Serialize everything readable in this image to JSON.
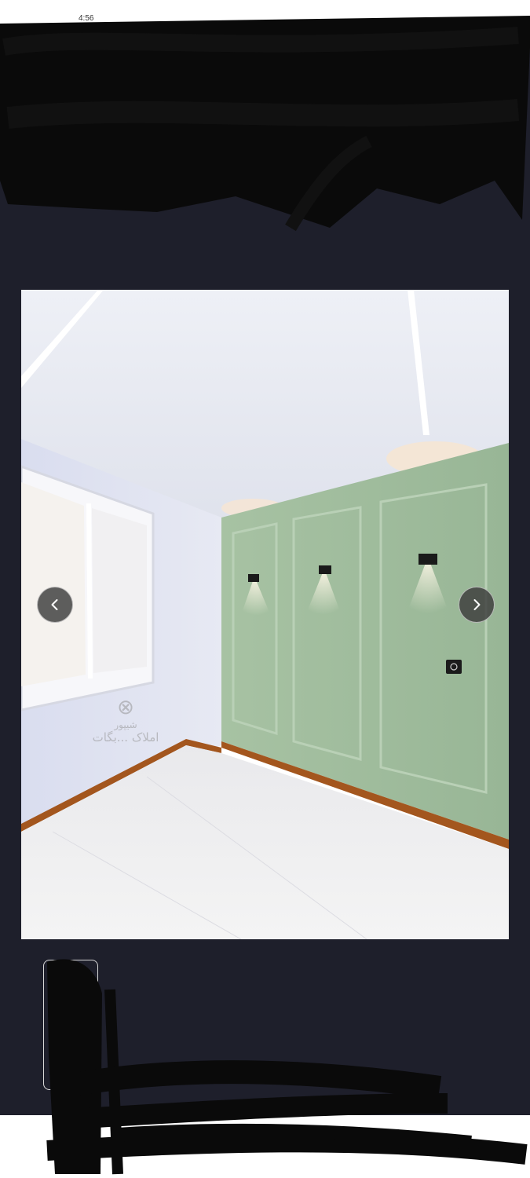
{
  "status_bar": {
    "time": "4:56"
  },
  "gallery": {
    "prev_button": {
      "icon": "chevron-left-icon",
      "label": "‹"
    },
    "next_button": {
      "icon": "chevron-right-icon",
      "label": "›"
    },
    "watermark": {
      "brand": "شیپور",
      "agency": "املاک ...بگات"
    },
    "colors": {
      "background": "#1e1f2b",
      "wall_accent": "#9db99a"
    }
  }
}
